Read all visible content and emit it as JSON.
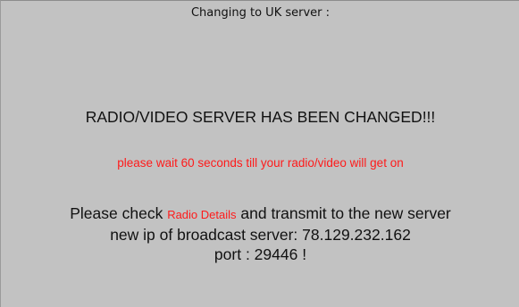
{
  "dialog": {
    "title": "Changing to UK server :",
    "headline": "RADIO/VIDEO SERVER HAS BEEN CHANGED!!!",
    "wait_message": "please wait 60 seconds till your radio/video will get on",
    "check_prefix": "Please check ",
    "check_link": "Radio Details",
    "check_suffix": " and transmit to the new server",
    "ip_line": "new ip of broadcast server: 78.129.232.162",
    "port_line": "port : 29446 !"
  },
  "colors": {
    "panel_background": "#c2c2c2",
    "accent_red": "#ff1a1a",
    "text": "#111111"
  }
}
